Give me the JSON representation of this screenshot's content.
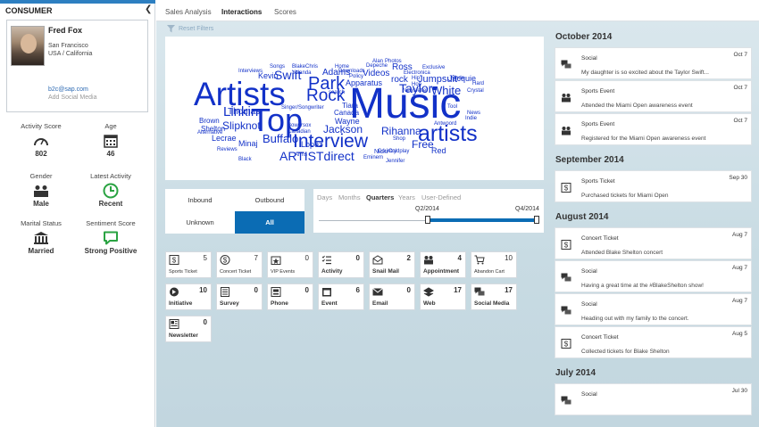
{
  "sidebar": {
    "title": "CONSUMER",
    "collapse_glyph": "❮",
    "profile": {
      "name": "Fred Fox",
      "city": "San Francisco",
      "region": "USA / California",
      "email": "b2c@sap.com",
      "add_social": "Add Social Media"
    },
    "kpis": [
      {
        "label": "Activity Score",
        "value": "802",
        "icon": "gauge-icon"
      },
      {
        "label": "Age",
        "value": "46",
        "icon": "calendar-icon"
      },
      {
        "label": "Gender",
        "value": "Male",
        "icon": "people-icon"
      },
      {
        "label": "Latest Activity",
        "value": "Recent",
        "icon": "clock-icon"
      },
      {
        "label": "Marital Status",
        "value": "Married",
        "icon": "bank-icon"
      },
      {
        "label": "Sentiment Score",
        "value": "Strong Positive",
        "icon": "speech-bubble-icon"
      }
    ]
  },
  "tabs": [
    "Sales Analysis",
    "Interactions",
    "Scores"
  ],
  "active_tab": "Interactions",
  "reset_filters": "Reset Filters",
  "word_cloud": {
    "words": [
      "Music",
      "Artists",
      "Top",
      "Interview",
      "artists",
      "Park",
      "Rock",
      "Linkin",
      "ARTISTdirect",
      "Buffalo",
      "Swift",
      "Taylor",
      "White",
      "Jackson",
      "Rihanna",
      "Free",
      "Slipknot",
      "Jumpsuit",
      "Adams",
      "Videos",
      "Apparatus",
      "rock",
      "Ross",
      "Jacquie",
      "Thomas",
      "Lecrae",
      "Minaj",
      "Shelton",
      "Brown",
      "Lopez",
      "Wayne",
      "Canada",
      "Tiara",
      "Kevin",
      "Red",
      "Nicki",
      "Alternative",
      "Reviews",
      "Black",
      "Arms",
      "Interviews",
      "Songs",
      "Blake",
      "Chris",
      "Yolanda",
      "Alan",
      "Photos",
      "Depeche",
      "Mode",
      "Exclusive",
      "Electronica",
      "Hip",
      "Hop",
      "Newsletter",
      "Downloads",
      "Home",
      "Policy",
      "Singer/Songwriter",
      "search",
      "Canadian",
      "Hard",
      "Crystal",
      "Tool",
      "News",
      "Indie",
      "Antwoord",
      "Jennifer",
      "Eminem",
      "Coldplay",
      "Country",
      "Bowersox",
      "Shop",
      "Songs",
      "Sale",
      "Ross",
      "Marley"
    ],
    "word_color": "#1231c8"
  },
  "segment": {
    "options": [
      "Inbound",
      "Outbound",
      "Unknown",
      "All"
    ],
    "selected": "All"
  },
  "timeline": {
    "granularity": [
      "Days",
      "Months",
      "Quarters",
      "Years",
      "User-Defined"
    ],
    "selected": "Quarters",
    "range_start": "Q2/2014",
    "range_end": "Q4/2014",
    "range_start_fraction": 0.5,
    "range_end_fraction": 1.0
  },
  "tiles": [
    {
      "name": "Sports Ticket",
      "count": "5",
      "icon": "dollar-ticket-icon",
      "light": true
    },
    {
      "name": "Concert Ticket",
      "count": "7",
      "icon": "dollar-circle-icon",
      "light": true
    },
    {
      "name": "VIP Events",
      "count": "0",
      "icon": "vip-event-icon",
      "light": true
    },
    {
      "name": "Activity",
      "count": "0",
      "icon": "checklist-icon",
      "light": false
    },
    {
      "name": "Snail Mail",
      "count": "2",
      "icon": "envelope-open-icon",
      "light": false
    },
    {
      "name": "Appointment",
      "count": "4",
      "icon": "appointment-icon",
      "light": false
    },
    {
      "name": "Abandon Cart",
      "count": "10",
      "icon": "cart-icon",
      "light": true
    },
    {
      "name": "Initiative",
      "count": "10",
      "icon": "initiative-icon",
      "light": false
    },
    {
      "name": "Survey",
      "count": "0",
      "icon": "survey-icon",
      "light": false
    },
    {
      "name": "Phone",
      "count": "0",
      "icon": "phone-icon",
      "light": false
    },
    {
      "name": "Event",
      "count": "6",
      "icon": "event-icon",
      "light": false
    },
    {
      "name": "Email",
      "count": "0",
      "icon": "email-icon",
      "light": false
    },
    {
      "name": "Web",
      "count": "17",
      "icon": "web-icon",
      "light": false
    },
    {
      "name": "Social Media",
      "count": "17",
      "icon": "social-icon",
      "light": false
    },
    {
      "name": "Newsletter",
      "count": "0",
      "icon": "newsletter-icon",
      "light": false
    }
  ],
  "feed": [
    {
      "month": "October 2014",
      "items": [
        {
          "type": "Social",
          "date": "Oct 7",
          "desc": "My daughter is so excited about the Taylor Swift...",
          "icon": "chat-icon"
        },
        {
          "type": "Sports Event",
          "date": "Oct 7",
          "desc": "Attended the Miami Open awareness event",
          "icon": "people-icon"
        },
        {
          "type": "Sports Event",
          "date": "Oct 7",
          "desc": "Registered for the Miami Open awareness event",
          "icon": "people-icon"
        }
      ]
    },
    {
      "month": "September 2014",
      "items": [
        {
          "type": "Sports Ticket",
          "date": "Sep 30",
          "desc": "Purchased tickets for Miami Open",
          "icon": "dollar-ticket-icon"
        }
      ]
    },
    {
      "month": "August 2014",
      "items": [
        {
          "type": "Concert Ticket",
          "date": "Aug 7",
          "desc": "Attended Blake Shelton concert",
          "icon": "dollar-ticket-icon"
        },
        {
          "type": "Social",
          "date": "Aug 7",
          "desc": "Having a great time at the #BlakeShelton show!",
          "icon": "chat-icon"
        },
        {
          "type": "Social",
          "date": "Aug 7",
          "desc": "Heading out with my family to the concert.",
          "icon": "chat-icon"
        },
        {
          "type": "Concert Ticket",
          "date": "Aug 5",
          "desc": "Collected tickets for Blake Shelton",
          "icon": "dollar-ticket-icon"
        }
      ]
    },
    {
      "month": "July 2014",
      "items": [
        {
          "type": "Social",
          "date": "Jul 30",
          "desc": "",
          "icon": "chat-icon"
        }
      ]
    }
  ],
  "colors": {
    "accent": "#0b6cb4",
    "header_bar": "#2d7fc1",
    "cloud_words": "#1231c8",
    "sentiment_green": "#2aa342"
  }
}
